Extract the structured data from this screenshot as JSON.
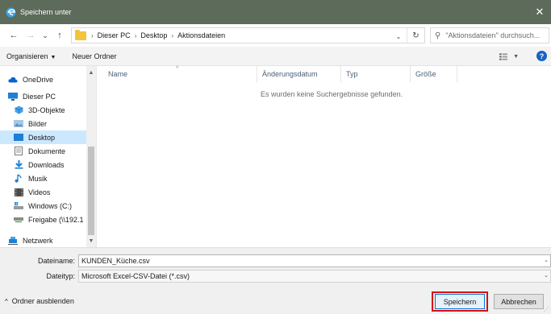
{
  "window": {
    "title": "Speichern unter",
    "close_label": "✕",
    "accent": "#5d6b5a"
  },
  "nav": {
    "back_icon": "←",
    "forward_icon": "→",
    "recent_icon": "⌄",
    "up_icon": "↑",
    "breadcrumbs": [
      "Dieser PC",
      "Desktop",
      "Aktionsdateien"
    ],
    "search_placeholder": "\"Aktionsdateien\" durchsuch..."
  },
  "toolbar": {
    "organize_label": "Organisieren",
    "new_folder_label": "Neuer Ordner"
  },
  "sidebar": {
    "items": [
      {
        "label": "OneDrive",
        "icon": "cloud-icon"
      },
      {
        "label": "Dieser PC",
        "icon": "computer-icon"
      },
      {
        "label": "3D-Objekte",
        "icon": "cube-icon"
      },
      {
        "label": "Bilder",
        "icon": "pictures-icon"
      },
      {
        "label": "Desktop",
        "icon": "desktop-icon",
        "selected": true
      },
      {
        "label": "Dokumente",
        "icon": "document-icon"
      },
      {
        "label": "Downloads",
        "icon": "download-icon"
      },
      {
        "label": "Musik",
        "icon": "music-icon"
      },
      {
        "label": "Videos",
        "icon": "video-icon"
      },
      {
        "label": "Windows (C:)",
        "icon": "drive-icon"
      },
      {
        "label": "Freigabe (\\\\192.1",
        "icon": "network-drive-icon"
      },
      {
        "label": "Netzwerk",
        "icon": "network-icon"
      }
    ]
  },
  "table": {
    "columns": [
      "Name",
      "Änderungsdatum",
      "Typ",
      "Größe"
    ],
    "empty_message": "Es wurden keine Suchergebnisse gefunden."
  },
  "form": {
    "filename_label": "Dateiname:",
    "filename_value": "KUNDEN_Küche.csv",
    "filetype_label": "Dateityp:",
    "filetype_value": "Microsoft Excel-CSV-Datei (*.csv)"
  },
  "footer": {
    "hide_folders_label": "Ordner ausblenden",
    "save_label": "Speichern",
    "cancel_label": "Abbrechen",
    "highlight_color": "#d80f16"
  }
}
